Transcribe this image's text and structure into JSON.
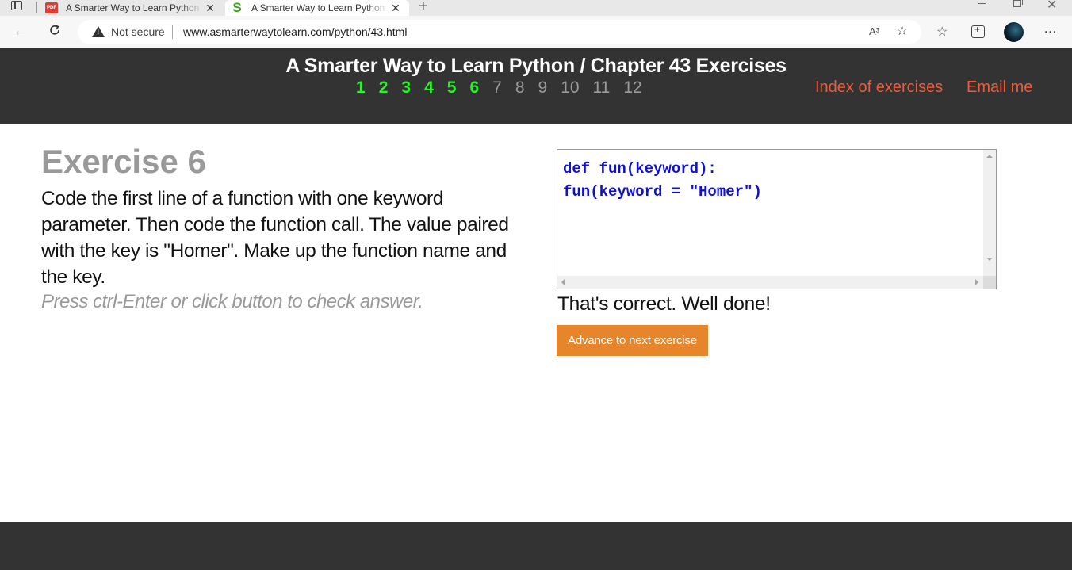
{
  "browser": {
    "tabs": [
      {
        "title": "A Smarter Way to Learn Python",
        "favicon": "pdf-icon",
        "active": false
      },
      {
        "title": "A Smarter Way to Learn Python",
        "favicon": "s-icon",
        "active": true
      }
    ],
    "security_label": "Not secure",
    "url": "www.asmarterwaytolearn.com/python/43.html",
    "read_aloud": "A³",
    "more": "…"
  },
  "header": {
    "title": "A Smarter Way to Learn Python / Chapter 43 Exercises",
    "pages": [
      {
        "label": "1",
        "done": true
      },
      {
        "label": "2",
        "done": true
      },
      {
        "label": "3",
        "done": true
      },
      {
        "label": "4",
        "done": true
      },
      {
        "label": "5",
        "done": true
      },
      {
        "label": "6",
        "done": true
      },
      {
        "label": "7",
        "done": false
      },
      {
        "label": "8",
        "done": false
      },
      {
        "label": "9",
        "done": false
      },
      {
        "label": "10",
        "done": false
      },
      {
        "label": "11",
        "done": false
      },
      {
        "label": "12",
        "done": false
      }
    ],
    "index_link": "Index of exercises",
    "email_link": "Email me",
    "colors": {
      "done": "#2ff02f",
      "todo": "#9a9a9a",
      "link": "#f05a38"
    }
  },
  "exercise": {
    "title": "Exercise 6",
    "instructions": "Code the first line of a function with one keyword parameter. Then code the function call. The value paired with the key is \"Homer\". Make up the function name and the key.",
    "hint": "Press ctrl-Enter or click button to check answer.",
    "code_lines": [
      "def fun(keyword):",
      "fun(keyword = \"Homer\")"
    ],
    "feedback": "That's correct. Well done!",
    "advance_label": "Advance to next exercise",
    "accent_color": "#e6852a"
  }
}
